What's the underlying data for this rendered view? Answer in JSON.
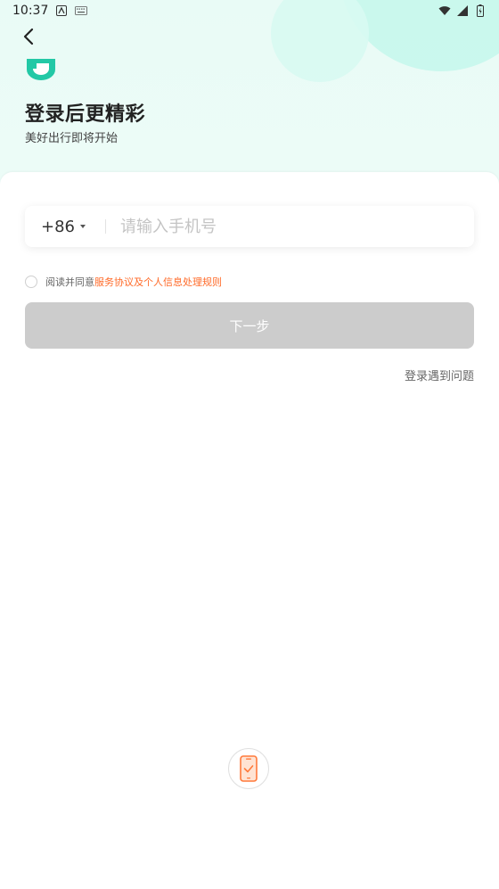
{
  "status_bar": {
    "time": "10:37"
  },
  "header": {
    "title": "登录后更精彩",
    "subtitle": "美好出行即将开始"
  },
  "phone": {
    "country_code": "+86",
    "placeholder": "请输入手机号",
    "value": ""
  },
  "agreement": {
    "prefix": "阅读并同意",
    "terms_link": "服务协议",
    "connector": "及",
    "privacy_link": "个人信息处理规则"
  },
  "next_button": {
    "label": "下一步"
  },
  "help": {
    "label": "登录遇到问题"
  },
  "colors": {
    "brand_green": "#23c8a6",
    "link_orange": "#ff6a28",
    "disabled_gray": "#cccccc"
  }
}
